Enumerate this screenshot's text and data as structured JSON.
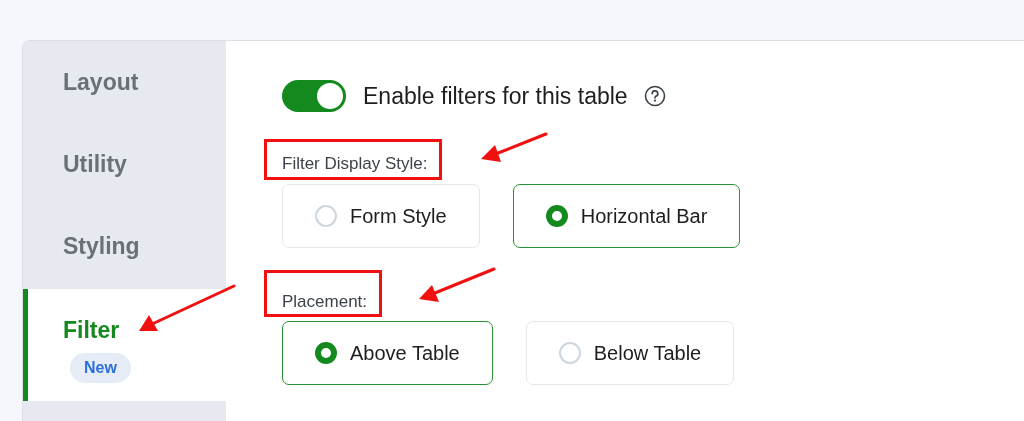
{
  "sidebar": {
    "items": [
      {
        "label": "Layout",
        "selected": false
      },
      {
        "label": "Utility",
        "selected": false
      },
      {
        "label": "Styling",
        "selected": false
      },
      {
        "label": "Filter",
        "selected": true,
        "badge": "New"
      }
    ]
  },
  "toggle": {
    "label": "Enable filters for this table",
    "on": true
  },
  "sections": [
    {
      "label": "Filter Display Style:",
      "options": [
        {
          "label": "Form Style",
          "selected": false
        },
        {
          "label": "Horizontal Bar",
          "selected": true
        }
      ]
    },
    {
      "label": "Placement:",
      "options": [
        {
          "label": "Above Table",
          "selected": true
        },
        {
          "label": "Below Table",
          "selected": false
        }
      ]
    }
  ]
}
